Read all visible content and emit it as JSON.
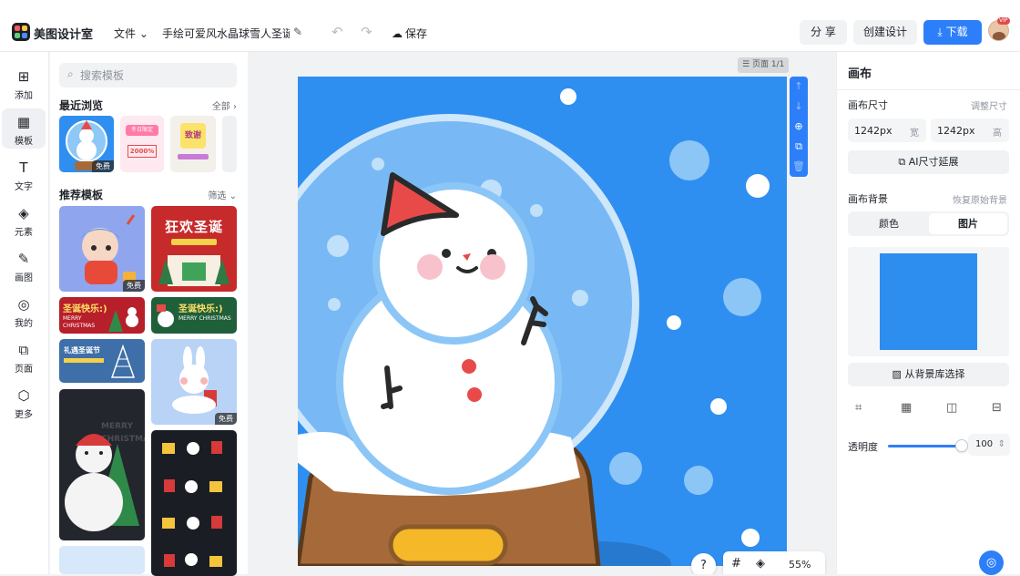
{
  "topbar": {
    "brand": "美图设计室",
    "file_menu": "文件",
    "doc_title": "手绘可爱风水晶球雪人圣诞...",
    "save": "保存",
    "share": "分 享",
    "create": "创建设计",
    "download": "下载",
    "vip_badge": "VIP"
  },
  "nav": [
    {
      "label": "添加",
      "icon": "⊞"
    },
    {
      "label": "模板",
      "icon": "▦"
    },
    {
      "label": "文字",
      "icon": "T"
    },
    {
      "label": "元素",
      "icon": "◈"
    },
    {
      "label": "画图",
      "icon": "✎"
    },
    {
      "label": "我的",
      "icon": "◎"
    },
    {
      "label": "页面",
      "icon": "⧉"
    },
    {
      "label": "更多",
      "icon": "⬡"
    }
  ],
  "panel": {
    "search_placeholder": "搜索模板",
    "recent_title": "最近浏览",
    "recent_link": "全部",
    "recommend_title": "推荐模板",
    "recommend_link": "筛选",
    "free_label": "免费",
    "templates": {
      "t2_title": "狂欢圣诞",
      "t3_title": "圣诞快乐:)",
      "t3_sub": "MERRY CHRISTMAS",
      "t5_title": "礼遇圣诞节",
      "t7_title": "MERRY CHRISTMAS",
      "recent2_title": "冬日限定",
      "recent2_price": "2000%",
      "recent3_title": "致谢"
    }
  },
  "canvas": {
    "page_label": "页面 1/1",
    "zoom": "55%",
    "help": "?",
    "art_bg": "#2f8ff0"
  },
  "right": {
    "title": "画布",
    "size_label": "画布尺寸",
    "adjust_size": "调整尺寸",
    "width_value": "1242px",
    "width_unit": "宽",
    "height_value": "1242px",
    "height_unit": "高",
    "ai_button": "AI尺寸延展",
    "bg_label": "画布背景",
    "restore_bg": "恢复原始背景",
    "tab_color": "颜色",
    "tab_image": "图片",
    "bg_color": "#2d8ef0",
    "from_library": "从背景库选择",
    "opacity_label": "透明度",
    "opacity_value": "100"
  }
}
